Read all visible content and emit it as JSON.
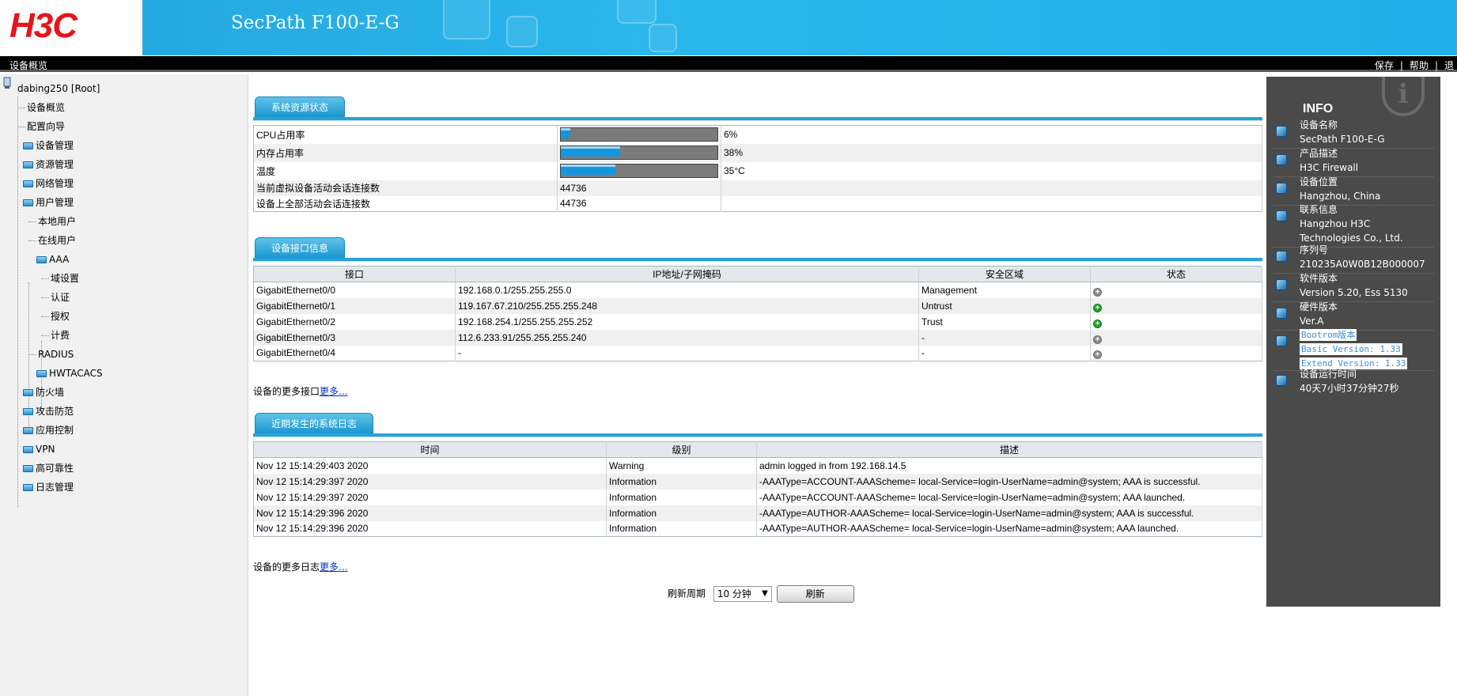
{
  "header": {
    "logo": "H3C",
    "product_title": "SecPath F100-E-G",
    "colors": {
      "header_blue": "#22a6df",
      "logo_red": "#e6141c"
    }
  },
  "menubar": {
    "page_name": "设备概览",
    "links": [
      "保存",
      "|",
      "帮助",
      "|",
      "退"
    ]
  },
  "sidebar": {
    "root": "dabing250 [Root]",
    "items": [
      "设备概览",
      "配置向导",
      "设备管理",
      "资源管理",
      "网络管理",
      "用户管理",
      "本地用户",
      "在线用户",
      "AAA",
      "域设置",
      "认证",
      "授权",
      "计费",
      "RADIUS",
      "HWTACACS",
      "防火墙",
      "攻击防范",
      "应用控制",
      "VPN",
      "高可靠性",
      "日志管理"
    ]
  },
  "resources": {
    "tab_label": "系统资源状态",
    "rows": [
      {
        "label": "CPU占用率",
        "value": "6%",
        "level": 0.06
      },
      {
        "label": "内存占用率",
        "value": "38%",
        "level": 0.38
      },
      {
        "label": "温度",
        "value": "35°C",
        "level": 0.35
      },
      {
        "label": "当前虚拟设备活动会话连接数",
        "value": "44736"
      },
      {
        "label": "设备上全部活动会话连接数",
        "value": "44736"
      }
    ]
  },
  "interfaces": {
    "tab_label": "设备接口信息",
    "headers": [
      "接口",
      "IP地址/子网掩码",
      "安全区域",
      "状态"
    ],
    "rows": [
      {
        "name": "GigabitEthernet0/0",
        "ip": "192.168.0.1/255.255.255.0",
        "zone": "Management",
        "status": "down"
      },
      {
        "name": "GigabitEthernet0/1",
        "ip": "119.167.67.210/255.255.255.248",
        "zone": "Untrust",
        "status": "up"
      },
      {
        "name": "GigabitEthernet0/2",
        "ip": "192.168.254.1/255.255.255.252",
        "zone": "Trust",
        "status": "up"
      },
      {
        "name": "GigabitEthernet0/3",
        "ip": "112.6.233.91/255.255.255.240",
        "zone": "-",
        "status": "down"
      },
      {
        "name": "GigabitEthernet0/4",
        "ip": "-",
        "zone": "-",
        "status": "down"
      }
    ],
    "more_prefix": "设备的更多接口",
    "more_link": "更多..."
  },
  "logs": {
    "tab_label": "近期发生的系统日志",
    "headers": [
      "时间",
      "级别",
      "描述"
    ],
    "rows": [
      {
        "time": "Nov 12 15:14:29:403 2020",
        "level": "Warning",
        "desc": "admin logged in from 192.168.14.5"
      },
      {
        "time": "Nov 12 15:14:29:397 2020",
        "level": "Information",
        "desc": "-AAAType=ACCOUNT-AAAScheme= local-Service=login-UserName=admin@system; AAA is successful."
      },
      {
        "time": "Nov 12 15:14:29:397 2020",
        "level": "Information",
        "desc": "-AAAType=ACCOUNT-AAAScheme= local-Service=login-UserName=admin@system; AAA launched."
      },
      {
        "time": "Nov 12 15:14:29:396 2020",
        "level": "Information",
        "desc": "-AAAType=AUTHOR-AAAScheme= local-Service=login-UserName=admin@system; AAA is successful."
      },
      {
        "time": "Nov 12 15:14:29:396 2020",
        "level": "Information",
        "desc": "-AAAType=AUTHOR-AAAScheme= local-Service=login-UserName=admin@system; AAA launched."
      }
    ],
    "more_prefix": "设备的更多日志",
    "more_link": "更多..."
  },
  "refresh": {
    "label": "刷新周期",
    "selected": "10 分钟",
    "button": "刷新"
  },
  "info": {
    "title": "INFO",
    "badge": "i",
    "items": [
      {
        "icon": "device-icon",
        "label": "设备名称",
        "value": "SecPath F100-E-G"
      },
      {
        "icon": "product-icon",
        "label": "产品描述",
        "value": "H3C Firewall"
      },
      {
        "icon": "location-icon",
        "label": "设备位置",
        "value": "Hangzhou, China"
      },
      {
        "icon": "contact-icon",
        "label": "联系信息",
        "value": "Hangzhou H3C Technologies Co., Ltd."
      },
      {
        "icon": "serial-icon",
        "label": "序列号",
        "value": "210235A0W0B12B000007"
      },
      {
        "icon": "software-icon",
        "label": "软件版本",
        "value": "Version 5.20, Ess 5130"
      },
      {
        "icon": "hardware-icon",
        "label": "硬件版本",
        "value": "Ver.A"
      }
    ],
    "bootrom": {
      "label": "Bootrom版本",
      "basic": "Basic Version:  1.33",
      "extend": "Extend Version:  1.33"
    },
    "uptime": {
      "label": "设备运行时间",
      "value": "40天7小时37分钟27秒"
    }
  }
}
